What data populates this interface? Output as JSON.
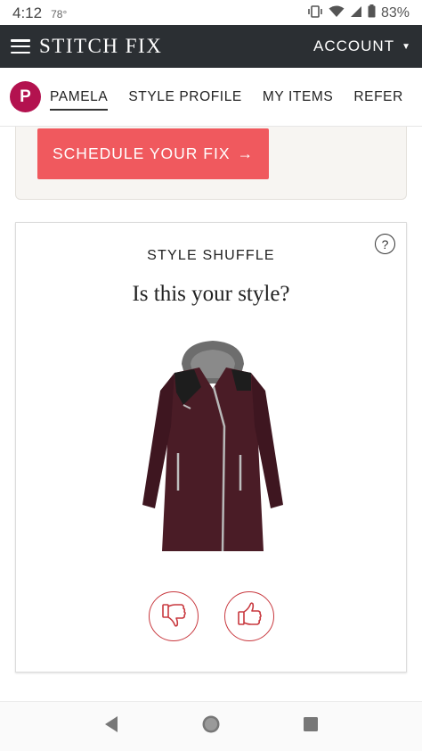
{
  "status_bar": {
    "time": "4:12",
    "temperature": "78°",
    "battery": "83%",
    "icons": [
      "vibrate-icon",
      "wifi-icon",
      "signal-icon",
      "battery-icon"
    ]
  },
  "header": {
    "brand": "STITCH FIX",
    "account_label": "ACCOUNT",
    "background_color": "#2b2f33"
  },
  "nav": {
    "avatar_initial": "P",
    "avatar_color": "#b3124f",
    "items": [
      {
        "label": "PAMELA",
        "active": true
      },
      {
        "label": "STYLE PROFILE",
        "active": false
      },
      {
        "label": "MY ITEMS",
        "active": false
      },
      {
        "label": "REFER",
        "active": false
      }
    ]
  },
  "fix": {
    "schedule_label": "SCHEDULE YOUR FIX",
    "arrow": "→",
    "button_color": "#f0595e"
  },
  "shuffle": {
    "help": "?",
    "title": "STYLE SHUFFLE",
    "question": "Is this your style?",
    "item_image": "burgundy-hooded-coat",
    "vote_color": "#c8383e"
  },
  "system_nav": {
    "icons": [
      "back-icon",
      "home-icon",
      "recents-icon"
    ]
  }
}
